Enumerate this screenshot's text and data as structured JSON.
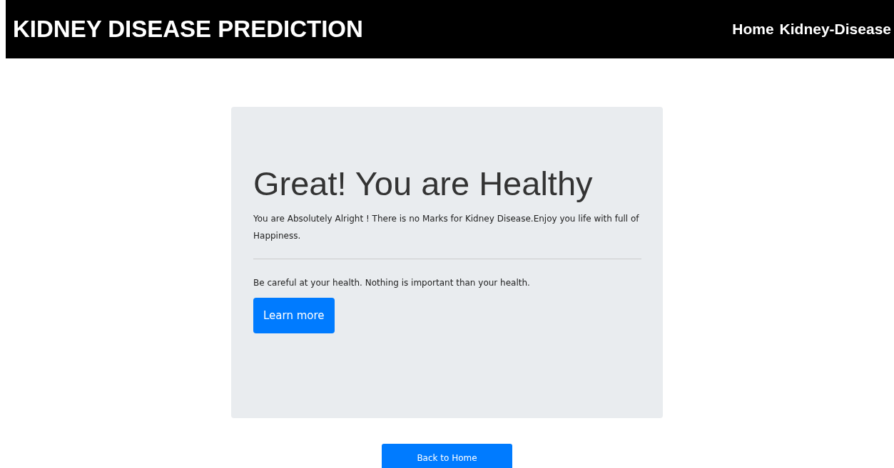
{
  "header": {
    "title": "KIDNEY DISEASE PREDICTION",
    "nav": [
      {
        "label": "Home"
      },
      {
        "label": "Kidney-Disease"
      }
    ]
  },
  "result": {
    "heading": "Great! You are Healthy",
    "message": "You are Absolutely Alright ! There is no Marks for Kidney Disease.Enjoy you life with full of Happiness.",
    "advice": "Be careful at your health. Nothing is important than your health.",
    "button": "Learn more"
  },
  "back_button": "Back to Home"
}
